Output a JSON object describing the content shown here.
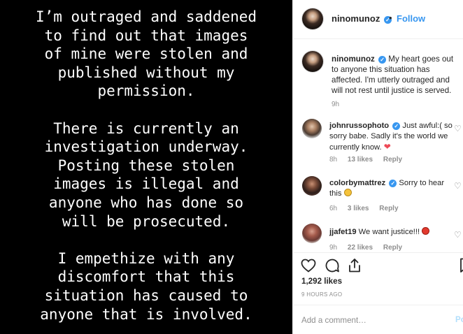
{
  "post_image": {
    "paragraphs": [
      [
        "I’m outraged and saddened",
        "to find out that images",
        "of mine were stolen and",
        "published without my",
        "permission."
      ],
      [
        "There is currently an",
        "investigation underway.",
        "Posting these stolen",
        "images is illegal and",
        "anyone who has done so",
        "will be prosecuted."
      ],
      [
        "I empethize with any",
        "discomfort that this",
        "situation has caused to",
        "anyone that is involved."
      ]
    ]
  },
  "header": {
    "username": "ninomunoz",
    "separator": "•",
    "follow_label": "Follow",
    "verified_mark": "✓"
  },
  "caption": {
    "username": "ninomunoz",
    "text": "My heart goes out to anyone this situation has affected. I'm utterly outraged and will not rest until justice is served.",
    "time": "9h"
  },
  "comments": [
    {
      "username": "johnrussophoto",
      "text": "Just awful:( so sorry babe. Sadly it's the world we currently know.",
      "time": "8h",
      "likes": "13 likes",
      "reply": "Reply"
    },
    {
      "username": "colorbymattrez",
      "text": "Sorry to hear this",
      "time": "6h",
      "likes": "3 likes",
      "reply": "Reply"
    },
    {
      "username": "jjafet19",
      "text": "We want justice!!!",
      "time": "9h",
      "likes": "22 likes",
      "reply": "Reply"
    }
  ],
  "likes_count": "1,292 likes",
  "post_time": "9 HOURS AGO",
  "add_comment": {
    "placeholder": "Add a comment…",
    "post_label": "Po"
  },
  "colors": {
    "accent": "#3897f0",
    "heart": "#ed4956",
    "muted": "#8e8e8e"
  },
  "icons": [
    "like-icon",
    "comment-icon",
    "share-icon",
    "save-icon",
    "verified-icon"
  ]
}
